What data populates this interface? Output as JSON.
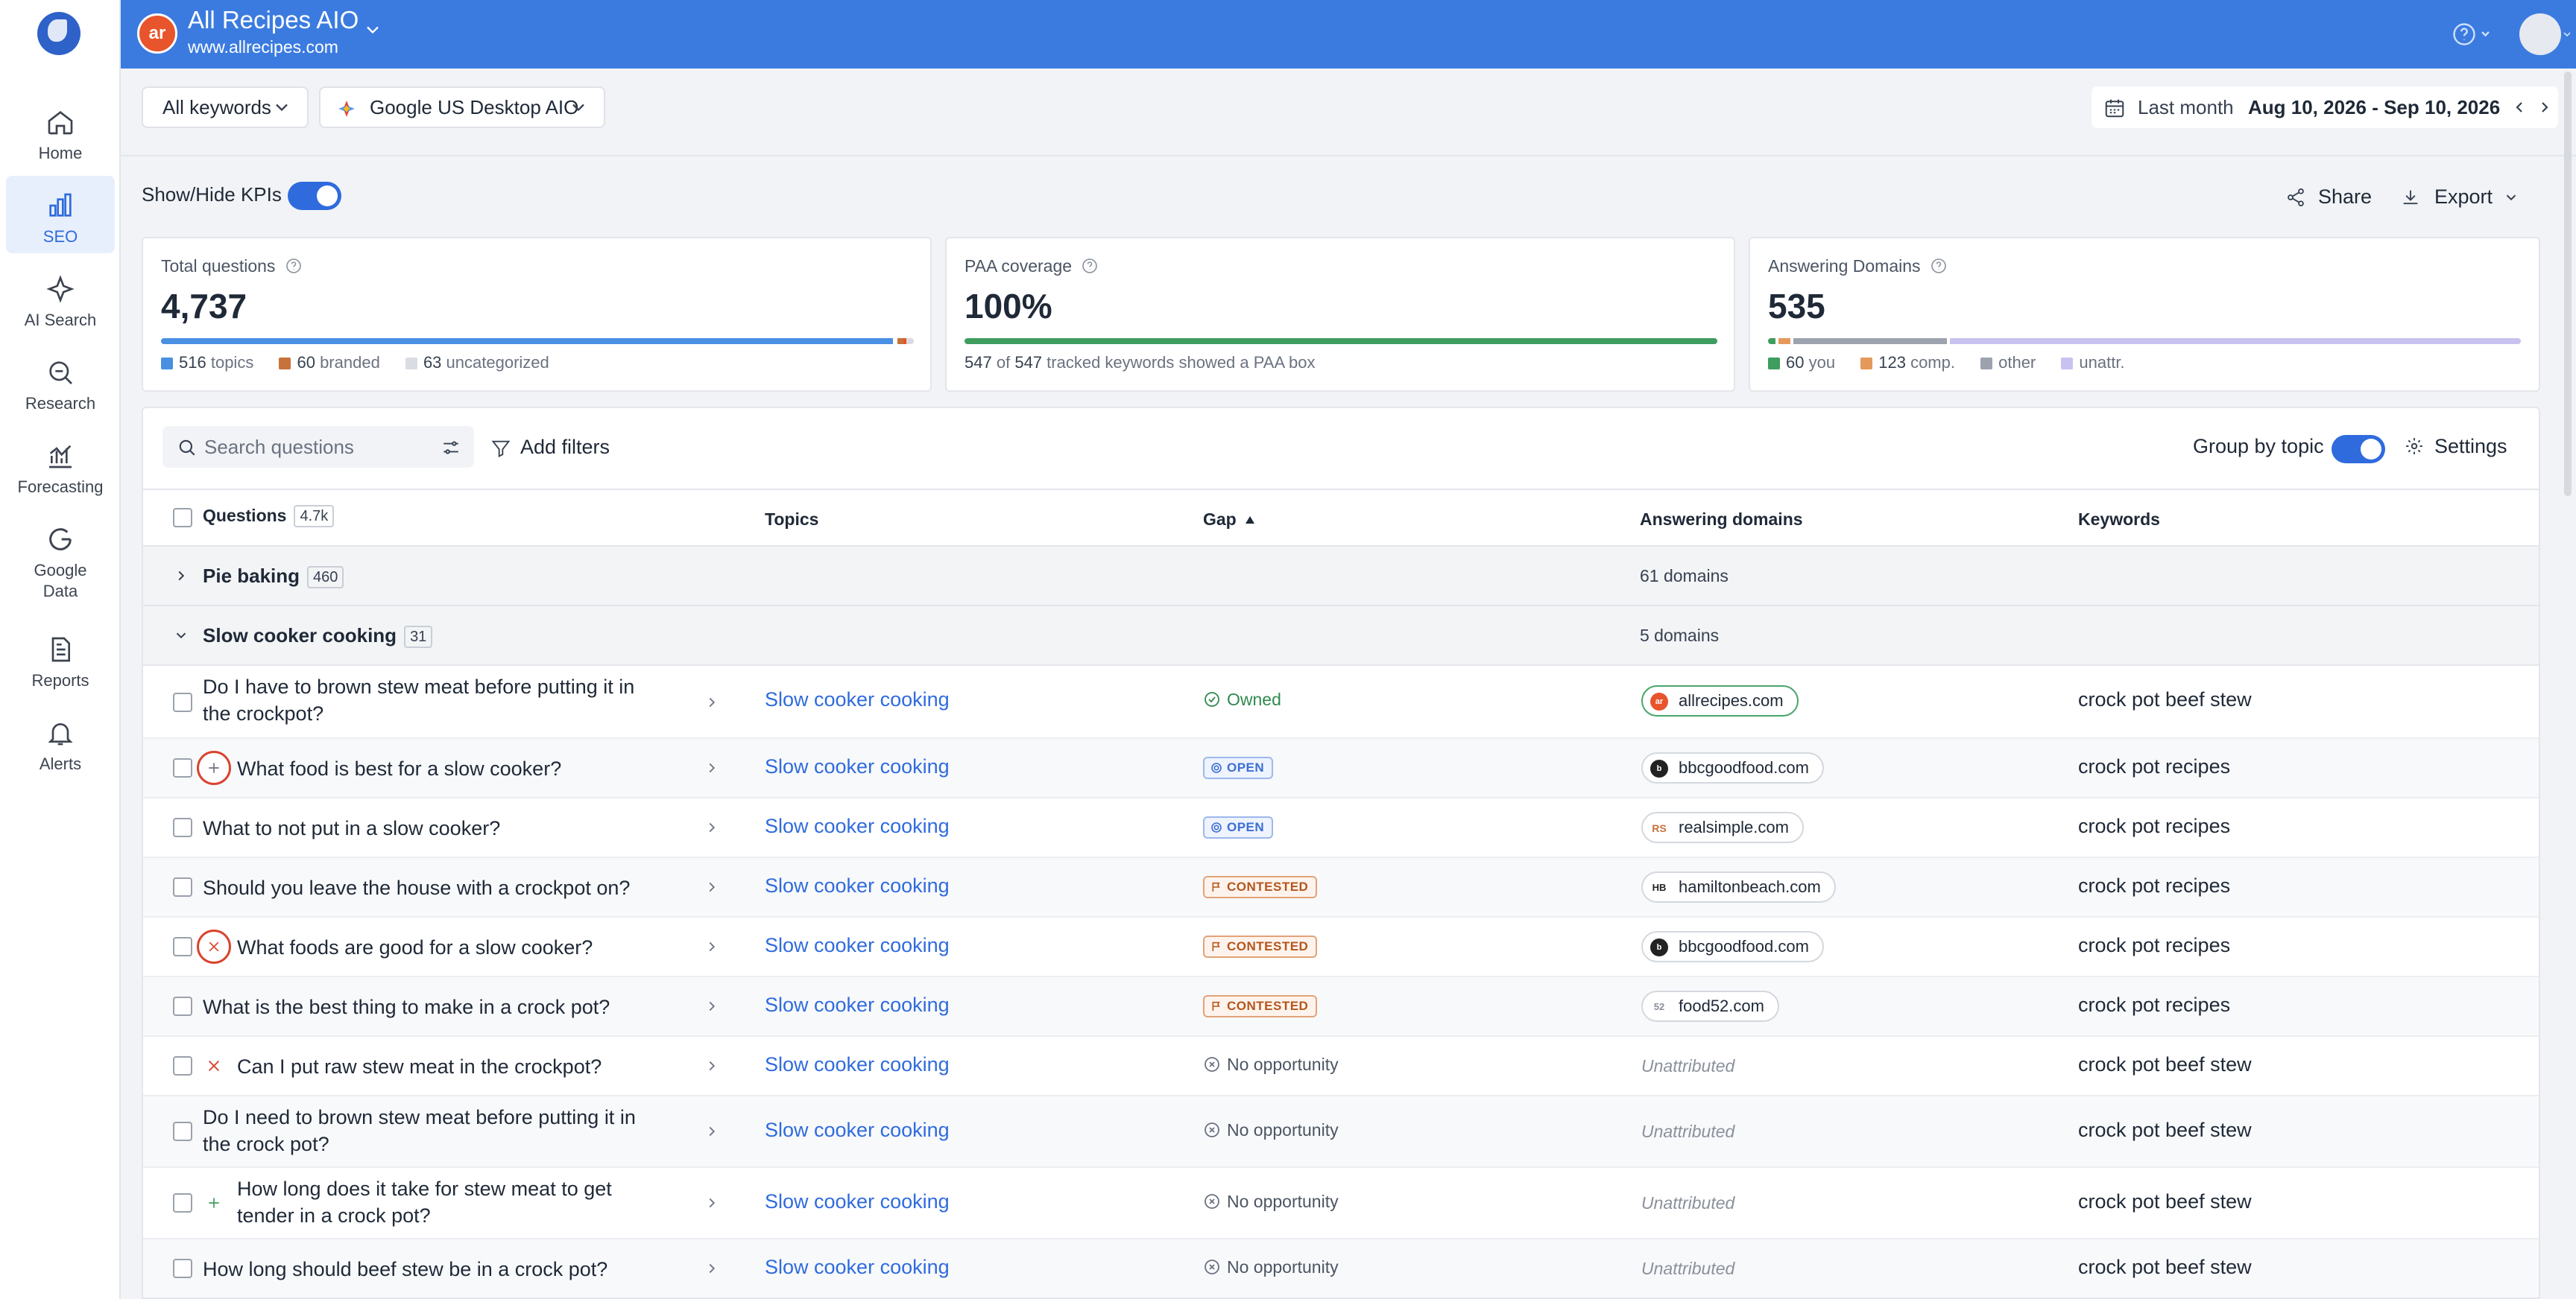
{
  "sidebar": {
    "items": [
      {
        "label": "Home",
        "icon": "home-icon"
      },
      {
        "label": "SEO",
        "icon": "bar-chart-icon",
        "active": true
      },
      {
        "label": "AI Search",
        "icon": "sparkle-icon"
      },
      {
        "label": "Research",
        "icon": "search-magnify-icon"
      },
      {
        "label": "Forecasting",
        "icon": "forecast-chart-icon"
      },
      {
        "label": "Google Data",
        "icon": "google-icon"
      },
      {
        "label": "Reports",
        "icon": "report-icon"
      },
      {
        "label": "Alerts",
        "icon": "bell-icon"
      }
    ]
  },
  "header": {
    "project_title": "All Recipes AIO",
    "project_url": "www.allrecipes.com",
    "logo_text": "ar",
    "accent_color": "#3b7be0"
  },
  "toolbar": {
    "keywords_filter": "All keywords",
    "engine_filter": "Google US Desktop AIO",
    "date_preset": "Last month",
    "date_range": "Aug 10, 2026 - Sep 10, 2026"
  },
  "kpi_controls": {
    "toggle_label": "Show/Hide KPIs",
    "share_label": "Share",
    "export_label": "Export"
  },
  "kpis": {
    "total_questions": {
      "label": "Total questions",
      "value": "4,737",
      "legend": [
        {
          "count": "516",
          "label": "topics",
          "color": "#4a90e2"
        },
        {
          "count": "60",
          "label": "branded",
          "color": "#c7723a"
        },
        {
          "count": "63",
          "label": "uncategorized",
          "color": "#d9dde3"
        }
      ]
    },
    "paa_coverage": {
      "label": "PAA coverage",
      "value": "100%",
      "fill_fraction": 1.0,
      "note_a": "547",
      "note_of": "of",
      "note_b": "547",
      "note_rest": "tracked keywords showed a PAA box"
    },
    "answering_domains": {
      "label": "Answering Domains",
      "value": "535",
      "legend": [
        {
          "count": "60",
          "label": "you",
          "color": "#3f9d5f"
        },
        {
          "count": "123",
          "label": "comp.",
          "color": "#e59a5b"
        },
        {
          "count": "",
          "label": "other",
          "color": "#9ca3af"
        },
        {
          "count": "",
          "label": "unattr.",
          "color": "#c8c2f0"
        }
      ]
    }
  },
  "table_controls": {
    "search_placeholder": "Search questions",
    "add_filters": "Add filters",
    "group_by_topic": "Group by topic",
    "settings": "Settings"
  },
  "columns": {
    "questions": "Questions",
    "questions_count": "4.7k",
    "topics": "Topics",
    "gap": "Gap",
    "answering_domains": "Answering domains",
    "keywords": "Keywords"
  },
  "groups": [
    {
      "name": "Pie baking",
      "count": "460",
      "domains": "61 domains",
      "expanded": false
    },
    {
      "name": "Slow cooker cooking",
      "count": "31",
      "domains": "5 domains",
      "expanded": true
    }
  ],
  "rows": [
    {
      "question": "Do I have to brown stew meat before putting it in the crockpot?",
      "topic": "Slow cooker cooking",
      "gap": "Owned",
      "domain": "allrecipes.com",
      "keyword": "crock pot beef stew"
    },
    {
      "question": "What food is best for a slow cooker?",
      "topic": "Slow cooker cooking",
      "gap": "OPEN",
      "domain": "bbcgoodfood.com",
      "keyword": "crock pot recipes"
    },
    {
      "question": "What to not put in a slow cooker?",
      "topic": "Slow cooker cooking",
      "gap": "OPEN",
      "domain": "realsimple.com",
      "keyword": "crock pot recipes"
    },
    {
      "question": "Should you leave the house with a crockpot on?",
      "topic": "Slow cooker cooking",
      "gap": "CONTESTED",
      "domain": "hamiltonbeach.com",
      "keyword": "crock pot recipes"
    },
    {
      "question": "What foods are good for a slow cooker?",
      "topic": "Slow cooker cooking",
      "gap": "CONTESTED",
      "domain": "bbcgoodfood.com",
      "keyword": "crock pot recipes"
    },
    {
      "question": "What is the best thing to make in a crock pot?",
      "topic": "Slow cooker cooking",
      "gap": "CONTESTED",
      "domain": "food52.com",
      "keyword": "crock pot recipes"
    },
    {
      "question": "Can I put raw stew meat in the crockpot?",
      "topic": "Slow cooker cooking",
      "gap": "No opportunity",
      "domain": "Unattributed",
      "keyword": "crock pot beef stew"
    },
    {
      "question": "Do I need to brown stew meat before putting it in the crock pot?",
      "topic": "Slow cooker cooking",
      "gap": "No opportunity",
      "domain": "Unattributed",
      "keyword": "crock pot beef stew"
    },
    {
      "question": "How long does it take for stew meat to get tender in a crock pot?",
      "topic": "Slow cooker cooking",
      "gap": "No opportunity",
      "domain": "Unattributed",
      "keyword": "crock pot beef stew"
    },
    {
      "question": "How long should beef stew be in a crock pot?",
      "topic": "Slow cooker cooking",
      "gap": "No opportunity",
      "domain": "Unattributed",
      "keyword": "crock pot beef stew"
    }
  ],
  "domain_icons": {
    "allrecipes": "ar",
    "realsimple": "RS",
    "hamiltonbeach": "HB",
    "bbcgoodfood": "b",
    "food52": "52"
  }
}
